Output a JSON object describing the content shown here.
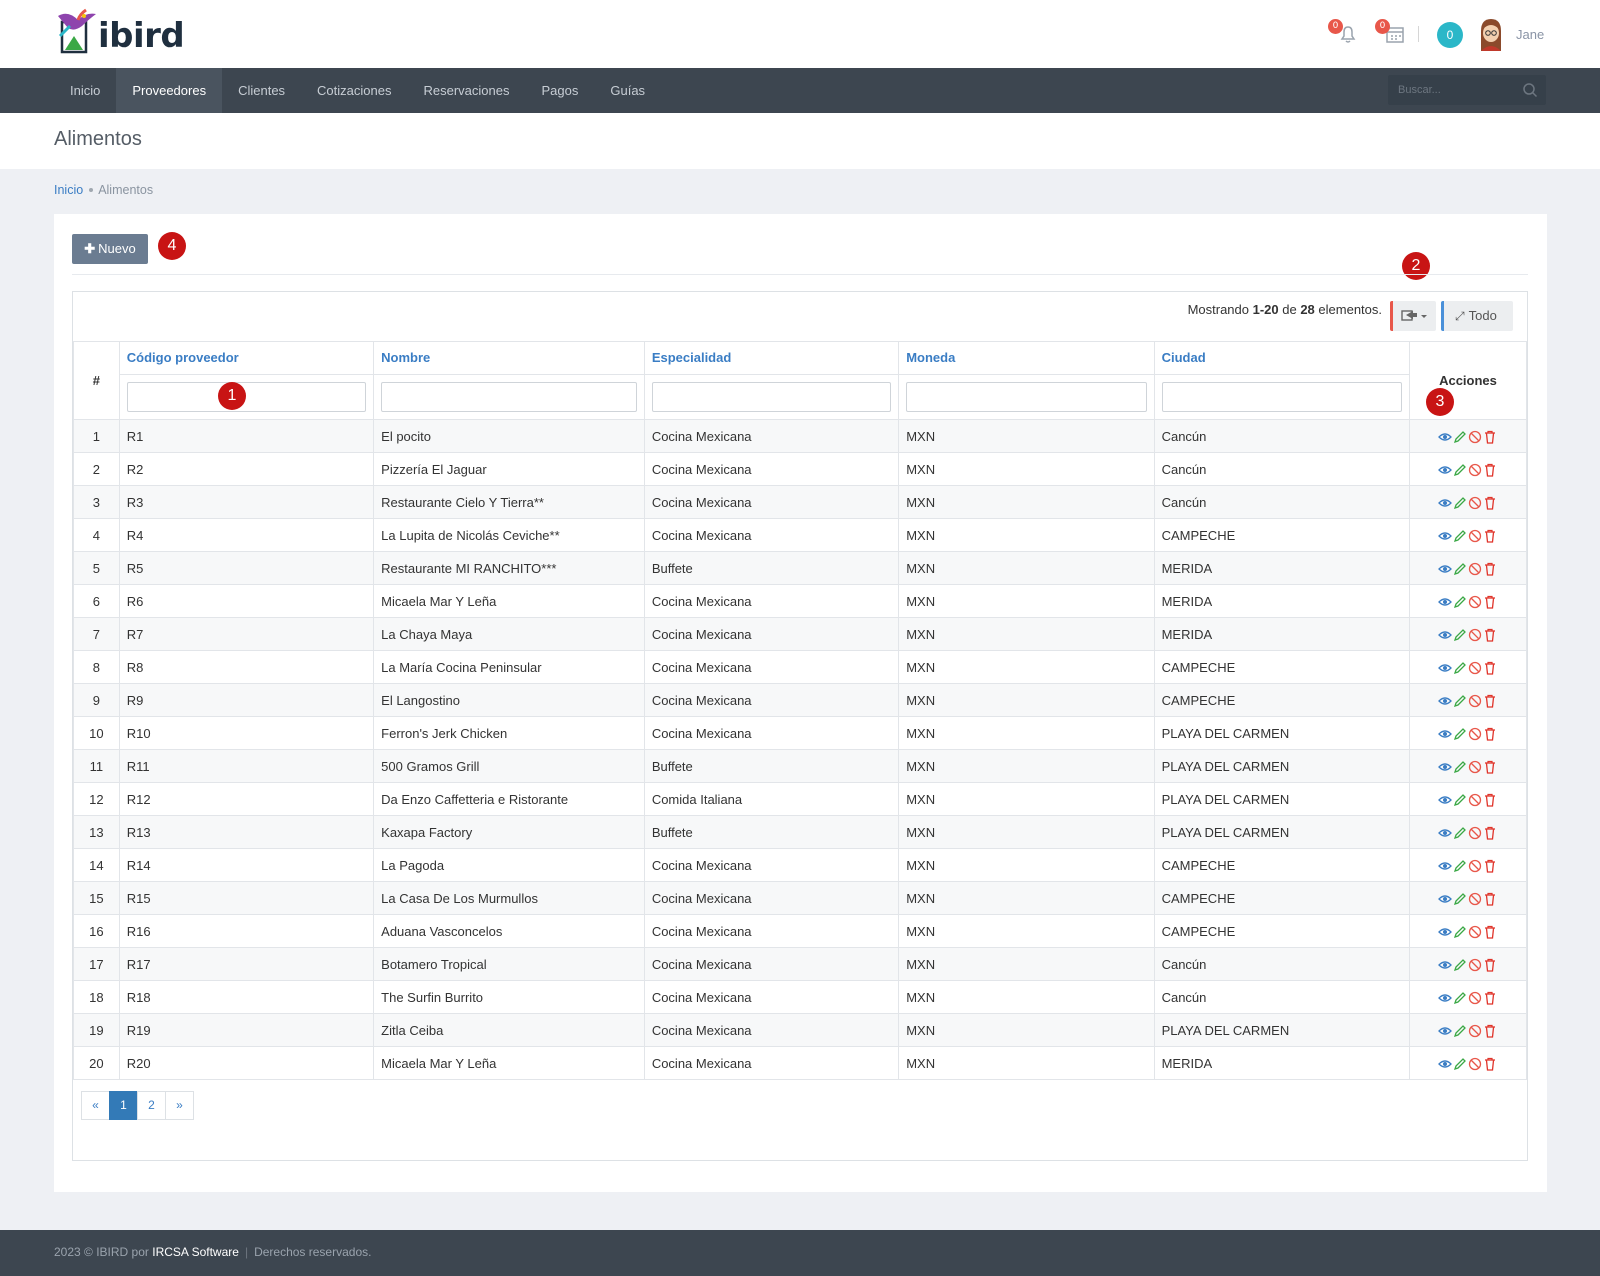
{
  "header": {
    "logo_text": "ibird",
    "notifications_count": "0",
    "calendar_count": "0",
    "cart_count": "0",
    "user_name": "Jane"
  },
  "nav": {
    "items": [
      {
        "label": "Inicio",
        "active": false
      },
      {
        "label": "Proveedores",
        "active": true
      },
      {
        "label": "Clientes",
        "active": false
      },
      {
        "label": "Cotizaciones",
        "active": false
      },
      {
        "label": "Reservaciones",
        "active": false
      },
      {
        "label": "Pagos",
        "active": false
      },
      {
        "label": "Guías",
        "active": false
      }
    ],
    "search_placeholder": "Buscar..."
  },
  "page": {
    "title": "Alimentos",
    "breadcrumb": [
      "Inicio",
      "Alimentos"
    ]
  },
  "toolbar": {
    "new_label": "Nuevo",
    "all_label": "Todo"
  },
  "markers": [
    "1",
    "2",
    "3",
    "4"
  ],
  "summary": {
    "prefix": "Mostrando ",
    "range": "1-20",
    "mid": " de ",
    "total": "28",
    "suffix": " elementos."
  },
  "table": {
    "columns": {
      "num": "#",
      "code": "Código proveedor",
      "name": "Nombre",
      "specialty": "Especialidad",
      "currency": "Moneda",
      "city": "Ciudad",
      "actions": "Acciones"
    },
    "rows": [
      {
        "n": "1",
        "code": "R1",
        "name": "El pocito",
        "specialty": "Cocina Mexicana",
        "currency": "MXN",
        "city": "Cancún"
      },
      {
        "n": "2",
        "code": "R2",
        "name": "Pizzería El Jaguar",
        "specialty": "Cocina Mexicana",
        "currency": "MXN",
        "city": "Cancún"
      },
      {
        "n": "3",
        "code": "R3",
        "name": "Restaurante Cielo Y Tierra**",
        "specialty": "Cocina Mexicana",
        "currency": "MXN",
        "city": "Cancún"
      },
      {
        "n": "4",
        "code": "R4",
        "name": "La Lupita de Nicolás Ceviche**",
        "specialty": "Cocina Mexicana",
        "currency": "MXN",
        "city": "CAMPECHE"
      },
      {
        "n": "5",
        "code": "R5",
        "name": "Restaurante MI RANCHITO***",
        "specialty": "Buffete",
        "currency": "MXN",
        "city": "MERIDA"
      },
      {
        "n": "6",
        "code": "R6",
        "name": "Micaela Mar Y Leña",
        "specialty": "Cocina Mexicana",
        "currency": "MXN",
        "city": "MERIDA"
      },
      {
        "n": "7",
        "code": "R7",
        "name": "La Chaya Maya",
        "specialty": "Cocina Mexicana",
        "currency": "MXN",
        "city": "MERIDA"
      },
      {
        "n": "8",
        "code": "R8",
        "name": "La María Cocina Peninsular",
        "specialty": "Cocina Mexicana",
        "currency": "MXN",
        "city": "CAMPECHE"
      },
      {
        "n": "9",
        "code": "R9",
        "name": "El Langostino",
        "specialty": "Cocina Mexicana",
        "currency": "MXN",
        "city": "CAMPECHE"
      },
      {
        "n": "10",
        "code": "R10",
        "name": "Ferron's Jerk Chicken",
        "specialty": "Cocina Mexicana",
        "currency": "MXN",
        "city": "PLAYA DEL CARMEN"
      },
      {
        "n": "11",
        "code": "R11",
        "name": "500 Gramos Grill",
        "specialty": "Buffete",
        "currency": "MXN",
        "city": "PLAYA DEL CARMEN"
      },
      {
        "n": "12",
        "code": "R12",
        "name": "Da Enzo Caffetteria e Ristorante",
        "specialty": "Comida Italiana",
        "currency": "MXN",
        "city": "PLAYA DEL CARMEN"
      },
      {
        "n": "13",
        "code": "R13",
        "name": "Kaxapa Factory",
        "specialty": "Buffete",
        "currency": "MXN",
        "city": "PLAYA DEL CARMEN"
      },
      {
        "n": "14",
        "code": "R14",
        "name": "La Pagoda",
        "specialty": "Cocina Mexicana",
        "currency": "MXN",
        "city": "CAMPECHE"
      },
      {
        "n": "15",
        "code": "R15",
        "name": "La Casa De Los Murmullos",
        "specialty": "Cocina Mexicana",
        "currency": "MXN",
        "city": "CAMPECHE"
      },
      {
        "n": "16",
        "code": "R16",
        "name": "Aduana Vasconcelos",
        "specialty": "Cocina Mexicana",
        "currency": "MXN",
        "city": "CAMPECHE"
      },
      {
        "n": "17",
        "code": "R17",
        "name": "Botamero Tropical",
        "specialty": "Cocina Mexicana",
        "currency": "MXN",
        "city": "Cancún"
      },
      {
        "n": "18",
        "code": "R18",
        "name": "The Surfin Burrito",
        "specialty": "Cocina Mexicana",
        "currency": "MXN",
        "city": "Cancún"
      },
      {
        "n": "19",
        "code": "R19",
        "name": "Zitla Ceiba",
        "specialty": "Cocina Mexicana",
        "currency": "MXN",
        "city": "PLAYA DEL CARMEN"
      },
      {
        "n": "20",
        "code": "R20",
        "name": "Micaela Mar Y Leña",
        "specialty": "Cocina Mexicana",
        "currency": "MXN",
        "city": "MERIDA"
      }
    ]
  },
  "pagination": {
    "prev": "«",
    "pages": [
      "1",
      "2"
    ],
    "current": "1",
    "next": "»"
  },
  "footer": {
    "copyright": "2023 © IBIRD por ",
    "company": "IRCSA Software",
    "separator": "|",
    "rights": "Derechos reservados."
  },
  "colors": {
    "nav_bg": "#3d4650",
    "link": "#3a7dc4",
    "marker": "#c81414",
    "view_icon": "#3a7dc4",
    "edit_icon": "#3aa845",
    "disable_icon": "#e8574a",
    "delete_icon": "#e0342a"
  }
}
